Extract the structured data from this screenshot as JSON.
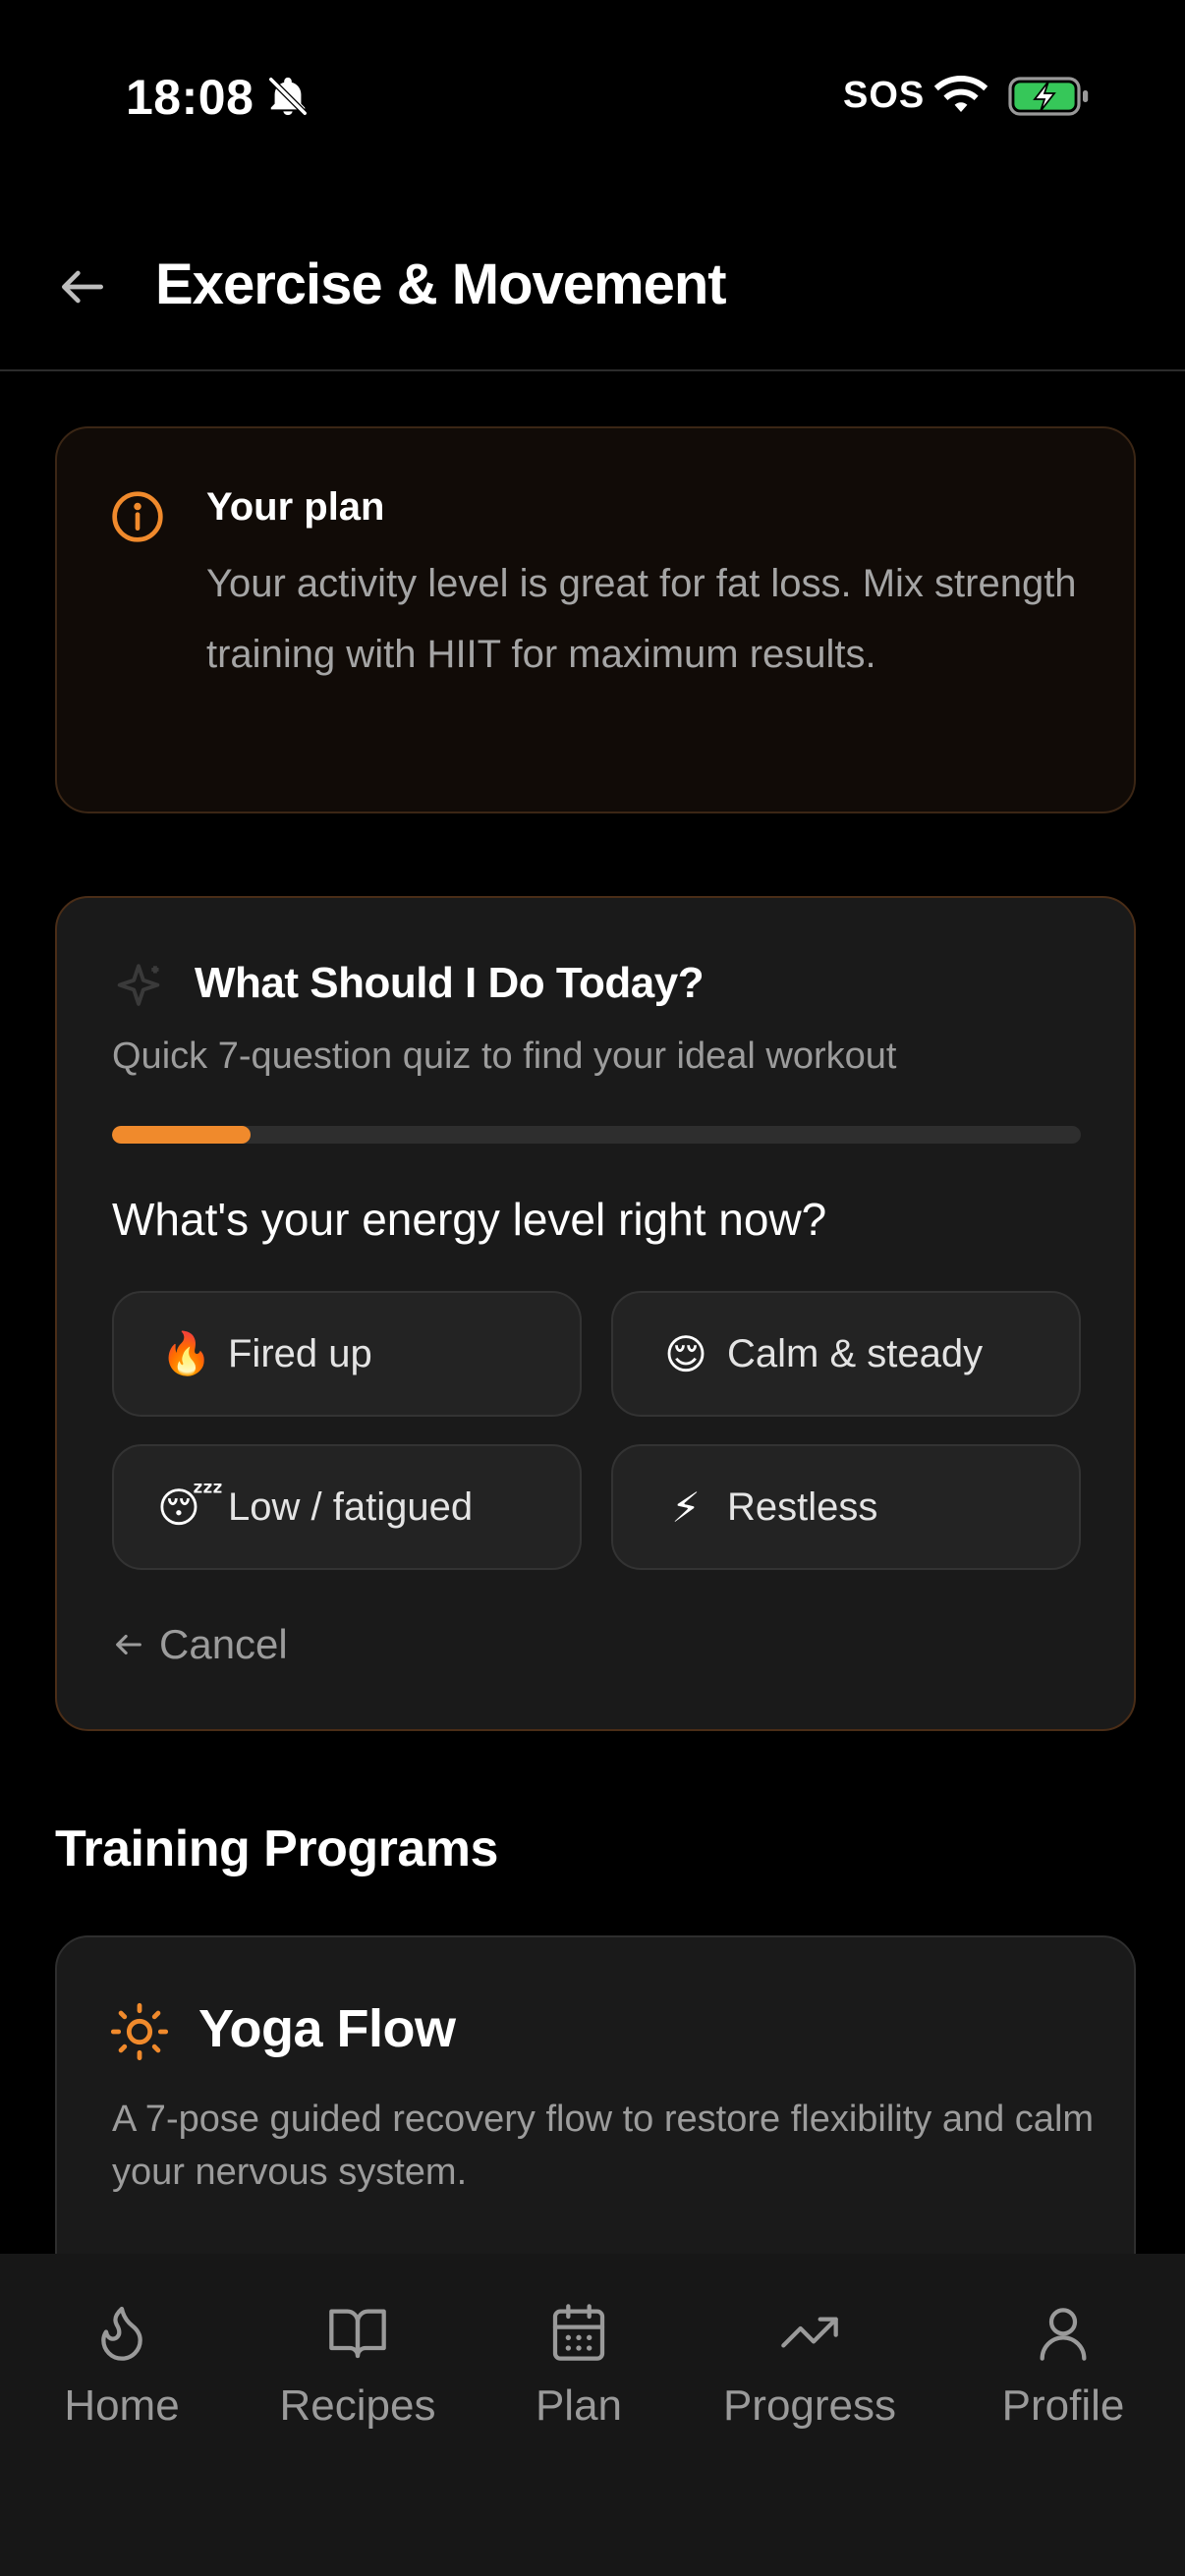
{
  "status_bar": {
    "time": "18:08",
    "carrier": "SOS",
    "icons": [
      "bell-slash-icon",
      "wifi-icon",
      "battery-charging-icon"
    ]
  },
  "header": {
    "title": "Exercise & Movement",
    "back_icon": "arrow-left-icon"
  },
  "plan_card": {
    "icon": "info-icon",
    "title": "Your plan",
    "text": "Your activity level is great for fat loss. Mix strength training with HIIT for maximum results."
  },
  "quiz": {
    "icon": "sparkle-icon",
    "title": "What Should I Do Today?",
    "subtitle": "Quick 7-question quiz to find your ideal workout",
    "progress": 0.143,
    "question": "What's your energy level right now?",
    "options": [
      {
        "emoji": "🔥",
        "label": "Fired up"
      },
      {
        "emoji": "😌",
        "label": "Calm & steady"
      },
      {
        "emoji": "😴",
        "label": "Low / fatigued"
      },
      {
        "emoji": "⚡",
        "label": "Restless"
      }
    ],
    "cancel_label": "Cancel"
  },
  "programs": {
    "section_title": "Training Programs",
    "items": [
      {
        "icon": "sun-icon",
        "title": "Yoga Flow",
        "description": "A 7-pose guided recovery flow to restore flexibility and calm your nervous system."
      }
    ]
  },
  "nav": {
    "items": [
      {
        "icon": "flame-icon",
        "label": "Home"
      },
      {
        "icon": "book-icon",
        "label": "Recipes"
      },
      {
        "icon": "calendar-icon",
        "label": "Plan"
      },
      {
        "icon": "trending-up-icon",
        "label": "Progress"
      },
      {
        "icon": "user-icon",
        "label": "Profile"
      }
    ]
  },
  "colors": {
    "accent": "#f08a2c",
    "background": "#000000",
    "card": "#1a1a1a",
    "muted_text": "#9c9c9c"
  }
}
